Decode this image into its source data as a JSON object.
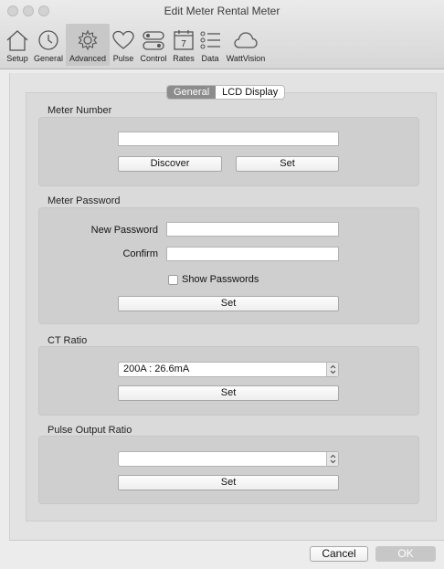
{
  "window": {
    "title": "Edit Meter Rental Meter"
  },
  "toolbar": {
    "items": [
      {
        "label": "Setup",
        "icon": "house-icon"
      },
      {
        "label": "General",
        "icon": "clock-icon"
      },
      {
        "label": "Advanced",
        "icon": "gear-icon",
        "selected": true
      },
      {
        "label": "Pulse",
        "icon": "heart-icon"
      },
      {
        "label": "Control",
        "icon": "toggle-switches-icon"
      },
      {
        "label": "Rates",
        "icon": "calendar-icon",
        "badge": "7"
      },
      {
        "label": "Data",
        "icon": "list-icon"
      },
      {
        "label": "WattVision",
        "icon": "cloud-icon"
      }
    ]
  },
  "tabs": {
    "general": "General",
    "lcd_display": "LCD Display",
    "active": "General"
  },
  "meter_number": {
    "title": "Meter Number",
    "value": "",
    "discover_label": "Discover",
    "set_label": "Set"
  },
  "meter_password": {
    "title": "Meter Password",
    "new_password_label": "New Password",
    "confirm_label": "Confirm",
    "show_passwords_label": "Show Passwords",
    "show_passwords_checked": false,
    "set_label": "Set"
  },
  "ct_ratio": {
    "title": "CT Ratio",
    "selected": "200A : 26.6mA",
    "set_label": "Set"
  },
  "pulse_output_ratio": {
    "title": "Pulse Output Ratio",
    "selected": "",
    "set_label": "Set"
  },
  "footer": {
    "cancel_label": "Cancel",
    "ok_label": "OK"
  }
}
